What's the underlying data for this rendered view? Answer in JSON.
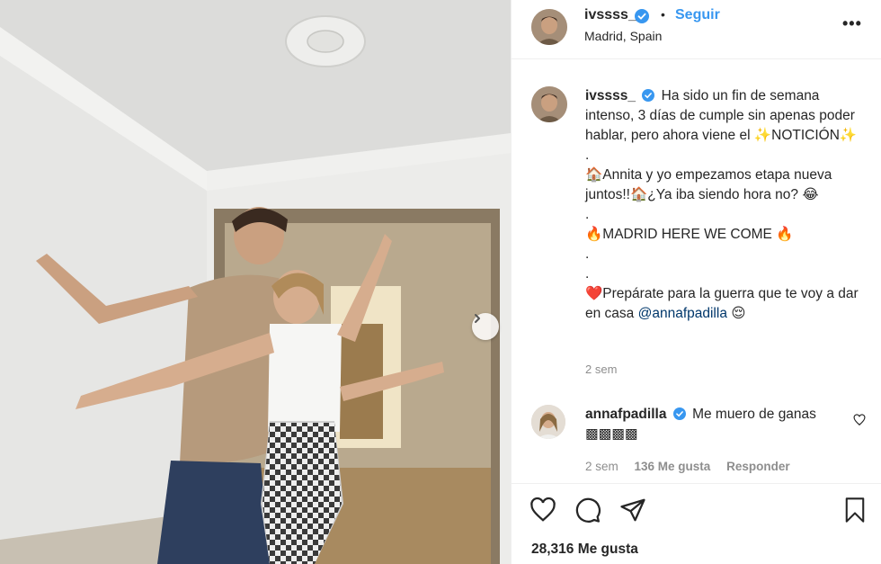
{
  "post": {
    "username": "ivssss_",
    "follow_label": "Seguir",
    "dot": "•",
    "location": "Madrid, Spain",
    "more": "•••"
  },
  "caption": {
    "username": "ivssss_",
    "lines": [
      "Ha sido un fin de semana intenso, 3 días de cumple sin apenas poder hablar, pero ahora viene el ✨NOTICIÓN✨",
      ".",
      "🏠Annita y yo empezamos etapa nueva juntos!!🏠¿Ya iba siendo hora no? 😂",
      ".",
      "🔥MADRID HERE WE COME 🔥",
      ".",
      ".",
      "❤️Prepárate para la guerra que te voy a dar en casa"
    ],
    "mention": "@annafpadilla",
    "end_emoji": "😌",
    "time": "2 sem"
  },
  "comment": {
    "username": "annafpadilla",
    "text": "Me muero de ganas ▩▩▩▩",
    "time": "2 sem",
    "likes": "136 Me gusta",
    "reply": "Responder"
  },
  "likes_count": "28,316 Me gusta",
  "icons": {
    "verified": "verified-badge-icon",
    "heart": "heart-icon",
    "comment": "comment-icon",
    "share": "share-icon",
    "save": "bookmark-icon",
    "next": "chevron-right-icon"
  },
  "colors": {
    "accent": "#3897f0",
    "mention": "#00376b",
    "muted": "#8e8e8e"
  }
}
